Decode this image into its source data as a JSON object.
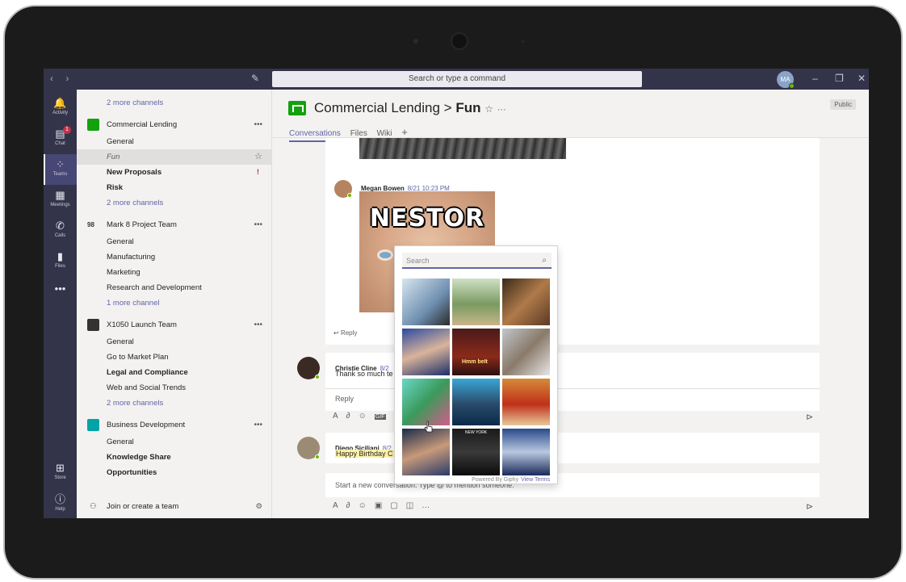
{
  "titlebar": {
    "nav": "‹  ›",
    "search_placeholder": "Search or type a command",
    "user_initials": "MA"
  },
  "rail": [
    {
      "label": "Activity",
      "icon": "bell-icon"
    },
    {
      "label": "Chat",
      "icon": "chat-icon",
      "badge": "1"
    },
    {
      "label": "Teams",
      "icon": "teams-icon"
    },
    {
      "label": "Meetings",
      "icon": "calendar-icon"
    },
    {
      "label": "Calls",
      "icon": "phone-icon"
    },
    {
      "label": "Files",
      "icon": "file-icon"
    },
    {
      "label": "Store",
      "icon": "store-icon"
    },
    {
      "label": "Help",
      "icon": "help-icon"
    }
  ],
  "teams": {
    "top_more": "2 more channels",
    "t1": {
      "name": "Commercial Lending",
      "ch1": "General",
      "ch2": "Fun",
      "ch3": "New Proposals",
      "ch4": "Risk",
      "more": "2 more channels"
    },
    "t2": {
      "name": "Mark 8 Project Team",
      "ch1": "General",
      "ch2": "Manufacturing",
      "ch3": "Marketing",
      "ch4": "Research and Development",
      "more": "1 more channel"
    },
    "t3": {
      "name": "X1050 Launch Team",
      "ch1": "General",
      "ch2": "Go to Market Plan",
      "ch3": "Legal and Compliance",
      "ch4": "Web and Social Trends",
      "more": "2 more channels"
    },
    "t4": {
      "name": "Business Development",
      "ch1": "General",
      "ch2": "Knowledge Share",
      "ch3": "Opportunities"
    },
    "join": "Join or create a team",
    "colors": {
      "commercial": "#13a10e",
      "x1050": "#333333",
      "business": "#00a4a6"
    }
  },
  "channel": {
    "team": "Commercial Lending",
    "separator": ">",
    "name": "Fun",
    "visibility": "Public",
    "tabs": [
      "Conversations",
      "Files",
      "Wiki"
    ],
    "add_tab": "+"
  },
  "messages": {
    "m1": {
      "sender": "Megan Bowen",
      "time": "8/21 10:23 PM",
      "gif_text": "NESTOR",
      "reply": "Reply"
    },
    "m2": {
      "sender": "Christie Cline",
      "time": "8/2",
      "text": "Thank so much te",
      "reply": "Reply"
    },
    "m3": {
      "sender": "Diego Siciliani",
      "time": "8/2",
      "text": "Happy Birthday C"
    }
  },
  "compose": {
    "placeholder": "Start a new conversation. Type @ to mention someone."
  },
  "giphy": {
    "search_placeholder": "Search",
    "powered_by": "Powered By Giphy",
    "view_terms": "View Terms",
    "cell_text": {
      "c6": "Hmm beIt",
      "c11": "NEW YORK"
    }
  },
  "accent": "#6264a7"
}
